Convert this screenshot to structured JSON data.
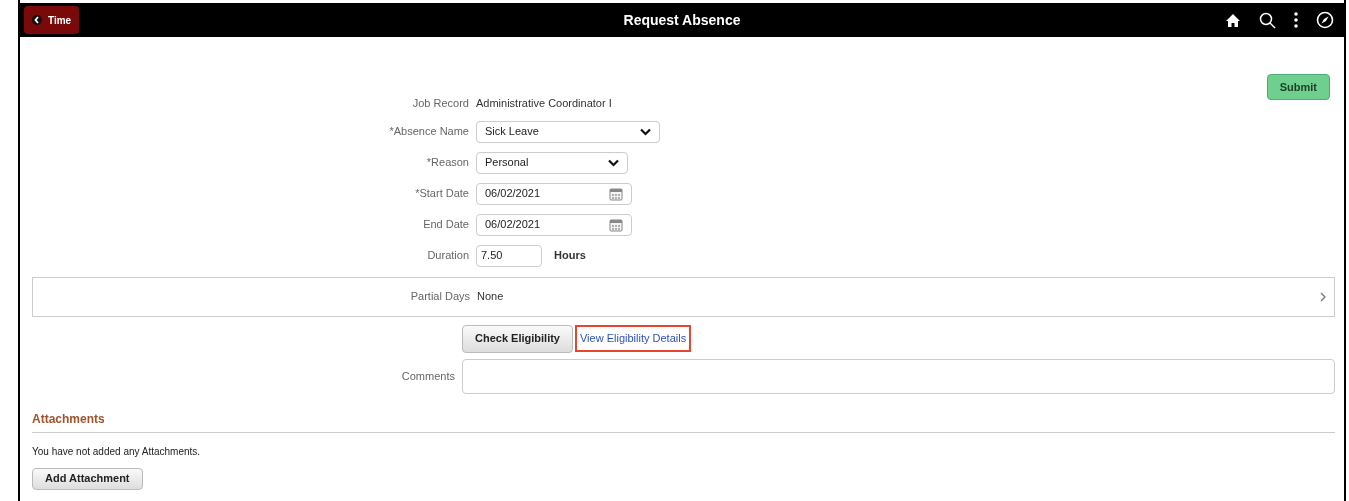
{
  "header": {
    "back_button": "Time",
    "title": "Request Absence"
  },
  "submit_button": "Submit",
  "fields": [
    {
      "kind": "text",
      "label": "Job Record",
      "value": "Administrative Coordinator I"
    },
    {
      "kind": "select",
      "label": "*Absence Name",
      "value": "Sick Leave"
    },
    {
      "kind": "select",
      "label": "*Reason",
      "value": "Personal"
    },
    {
      "kind": "date",
      "label": "*Start Date",
      "value": "06/02/2021"
    },
    {
      "kind": "date",
      "label": "End Date",
      "value": "06/02/2021"
    },
    {
      "kind": "number",
      "label": "Duration",
      "value": "7.50",
      "unit": "Hours"
    }
  ],
  "partial_days": {
    "label": "Partial Days",
    "value": "None"
  },
  "check_eligibility_button": "Check Eligibility",
  "eligibility_link": {
    "text": "View Eligibility Details",
    "highlighted": true
  },
  "comments": {
    "label": "Comments"
  },
  "attachments": {
    "title": "Attachments",
    "message": "You have not added any Attachments.",
    "button": "Add Attachment"
  }
}
